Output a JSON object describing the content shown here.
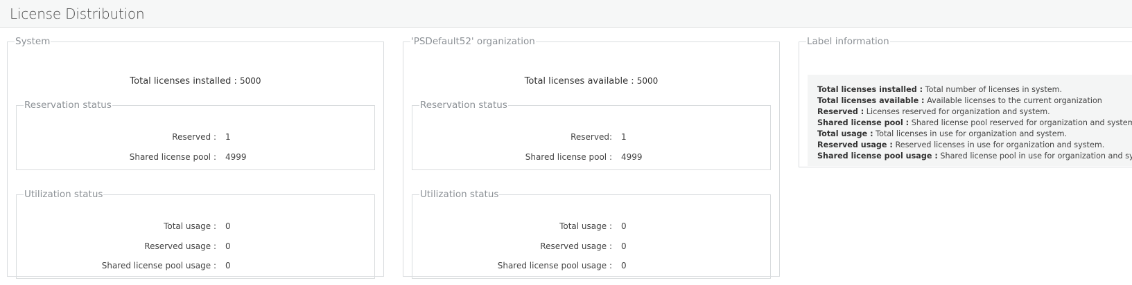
{
  "page": {
    "title": "License Distribution"
  },
  "system": {
    "legend": "System",
    "total_label": "Total licenses installed : ",
    "total_value": "5000",
    "reservation": {
      "legend": "Reservation status",
      "rows": [
        {
          "label": "Reserved :",
          "value": "1"
        },
        {
          "label": "Shared license pool :",
          "value": "4999"
        }
      ]
    },
    "utilization": {
      "legend": "Utilization status",
      "rows": [
        {
          "label": "Total usage :",
          "value": "0"
        },
        {
          "label": "Reserved usage :",
          "value": "0"
        },
        {
          "label": "Shared license pool usage :",
          "value": "0"
        }
      ]
    }
  },
  "organization": {
    "legend": "'PSDefault52' organization",
    "total_label": "Total licenses available : ",
    "total_value": "5000",
    "reservation": {
      "legend": "Reservation status",
      "rows": [
        {
          "label": "Reserved:",
          "value": "1"
        },
        {
          "label": "Shared license pool :",
          "value": "4999"
        }
      ]
    },
    "utilization": {
      "legend": "Utilization status",
      "rows": [
        {
          "label": "Total usage :",
          "value": "0"
        },
        {
          "label": "Reserved usage :",
          "value": "0"
        },
        {
          "label": "Shared license pool usage :",
          "value": "0"
        }
      ]
    }
  },
  "label_info": {
    "legend": "Label information",
    "items": [
      {
        "term": "Total licenses installed :",
        "desc": " Total number of licenses in system."
      },
      {
        "term": "Total licenses available :",
        "desc": " Available licenses to the current organization"
      },
      {
        "term": "Reserved :",
        "desc": " Licenses reserved for organization and system."
      },
      {
        "term": "Shared license pool :",
        "desc": " Shared license pool reserved for organization and system."
      },
      {
        "term": "Total usage :",
        "desc": " Total licenses in use for organization and system."
      },
      {
        "term": "Reserved usage :",
        "desc": " Reserved licenses in use for organization and system."
      },
      {
        "term": "Shared license pool usage :",
        "desc": " Shared license pool in use for organization and system."
      }
    ]
  }
}
